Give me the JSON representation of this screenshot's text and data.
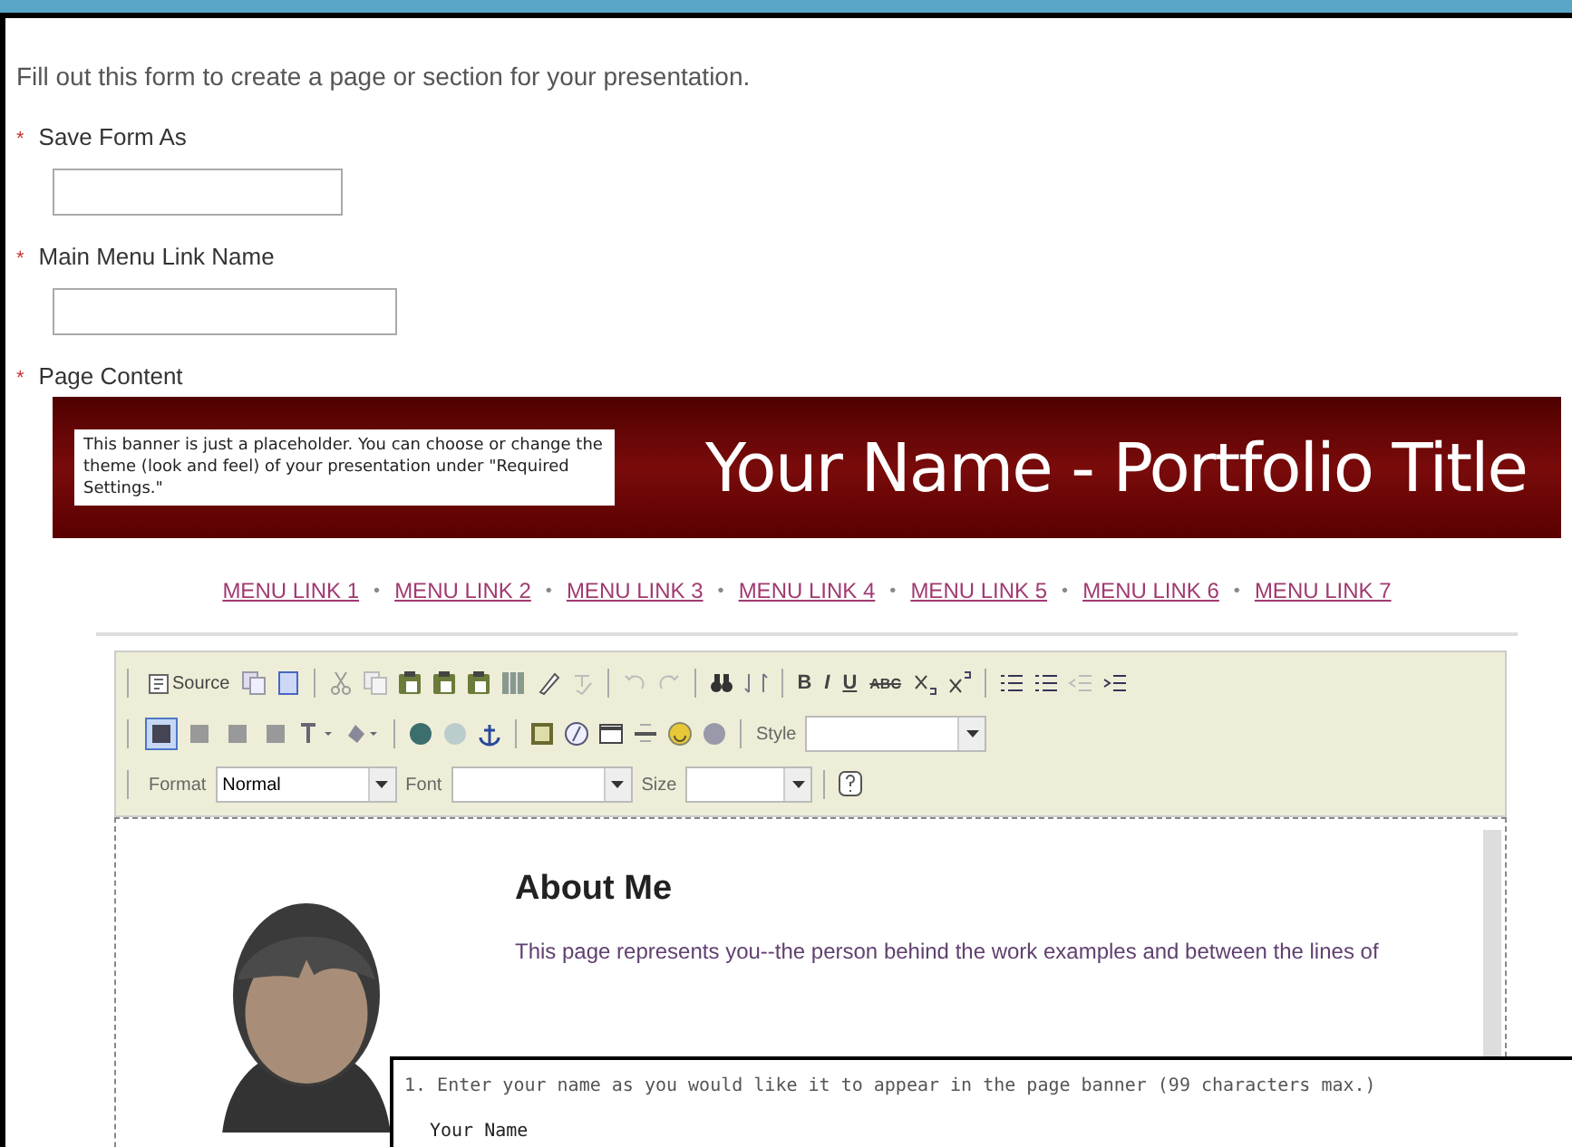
{
  "intro": "Fill out this form to create a page or section for your presentation.",
  "fields": [
    {
      "marker": "*",
      "label": "Save Form As",
      "kind": "text"
    },
    {
      "marker": "*",
      "label": "Main Menu Link Name",
      "kind": "text"
    },
    {
      "marker": "*",
      "label": "Page Content",
      "kind": "editor"
    }
  ],
  "banner": {
    "note": "This banner is just a placeholder.  You can choose or change the theme (look and feel) of your presentation under \"Required Settings.\"",
    "title": "Your Name - Portfolio Title"
  },
  "menu_links": [
    {
      "text": "MENU LINK 1"
    },
    {
      "separator": "•",
      "text": "MENU LINK 2"
    },
    {
      "separator": "•",
      "text": "MENU LINK 3"
    },
    {
      "separator": "•",
      "text": "MENU LINK 4"
    },
    {
      "separator": "•",
      "text": "MENU LINK 5"
    },
    {
      "separator": "•",
      "text": "MENU LINK 6"
    },
    {
      "separator": "•",
      "text": "MENU LINK 7"
    }
  ],
  "toolbar": {
    "source_label": "Source",
    "format_buttons": [
      {
        "label": "B",
        "kind": "bold"
      },
      {
        "label": "I",
        "kind": "italic"
      },
      {
        "label": "U",
        "kind": "underline"
      },
      {
        "label": "ABC",
        "kind": "strike"
      }
    ],
    "align_buttons": [
      {
        "selected": true
      },
      {
        "selected": false
      },
      {
        "selected": false
      },
      {
        "selected": false
      }
    ],
    "dropdowns": [
      {
        "label": "Style"
      },
      {
        "label": "Format",
        "value": "Normal"
      },
      {
        "label": "Font"
      },
      {
        "label": "Size"
      }
    ]
  },
  "content": {
    "heading": "About Me",
    "paragraph": "This page represents you--the person behind the work examples and between the lines of"
  },
  "popup": {
    "instruction": "1. Enter your name as you would like it to appear in the page banner (99 characters max.)",
    "field_label": "Your Name"
  }
}
